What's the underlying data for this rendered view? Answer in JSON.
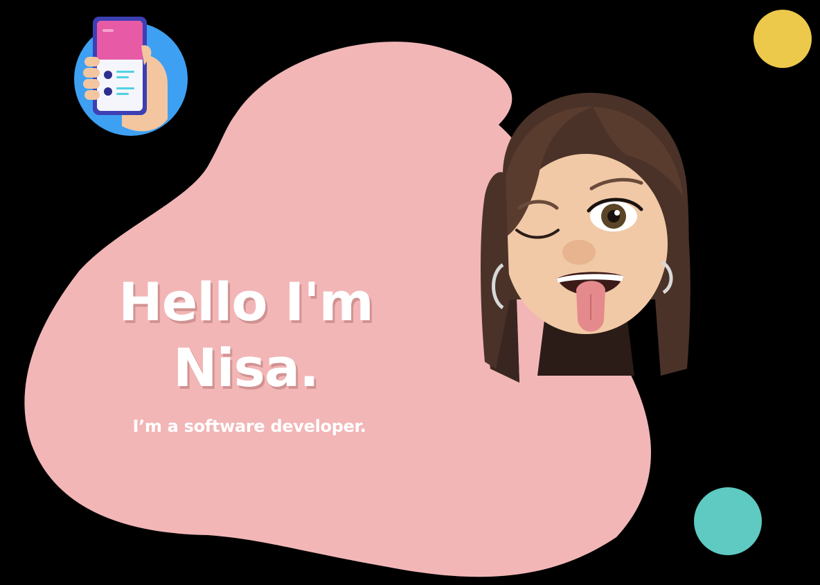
{
  "hero": {
    "title_line1": "Hello I'm",
    "title_line2": "Nisa.",
    "subtitle": "I’m a software developer."
  },
  "colors": {
    "background": "#000000",
    "blob": "#f2b6b6",
    "dot_yellow": "#ecc94b",
    "dot_teal": "#5ecac2",
    "icon_circle": "#3ea0f2"
  },
  "icons": {
    "phone": "phone-in-hand-icon",
    "avatar": "memoji-avatar"
  }
}
